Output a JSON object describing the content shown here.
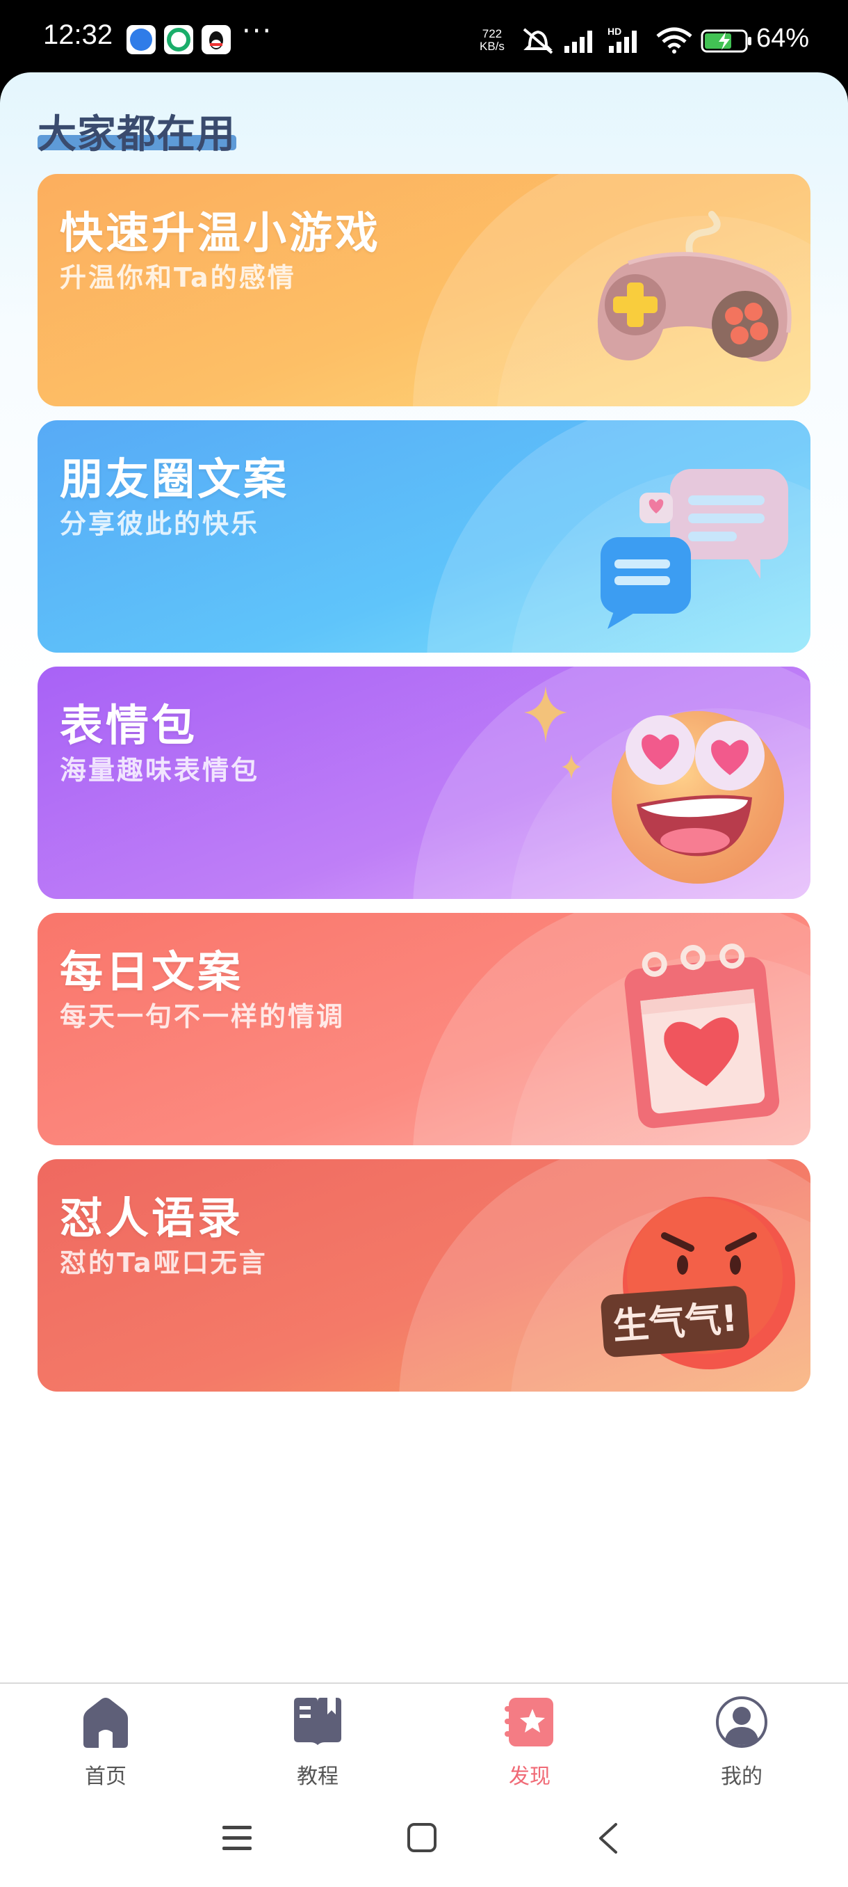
{
  "status_bar": {
    "time": "12:32",
    "net_speed_value": "722",
    "net_speed_unit": "KB/s",
    "battery_percent": "64%",
    "icons": [
      "browser-icon",
      "app-icon",
      "qq-icon",
      "more-icon",
      "mute-icon",
      "signal-icon",
      "signal-hd-icon",
      "wifi-icon",
      "battery-charging-icon"
    ]
  },
  "section": {
    "title": "大家都在用"
  },
  "cards": [
    {
      "title": "快速升温小游戏",
      "subtitle": "升温你和Ta的感情",
      "art": "gamepad-icon",
      "color": "#fdb25f"
    },
    {
      "title": "朋友圈文案",
      "subtitle": "分享彼此的快乐",
      "art": "chat-bubbles-icon",
      "color": "#5ab3f7"
    },
    {
      "title": "表情包",
      "subtitle": "海量趣味表情包",
      "art": "heart-eyes-emoji-icon",
      "color": "#b06cf6"
    },
    {
      "title": "每日文案",
      "subtitle": "每天一句不一样的情调",
      "art": "heart-calendar-icon",
      "color": "#fa7b70"
    },
    {
      "title": "怼人语录",
      "subtitle": "怼的Ta哑口无言",
      "art": "angry-face-icon",
      "art_text": "生气气!",
      "color": "#ef6b60"
    }
  ],
  "bottom_nav": {
    "items": [
      {
        "label": "首页",
        "icon": "home-icon",
        "active": false
      },
      {
        "label": "教程",
        "icon": "book-icon",
        "active": false
      },
      {
        "label": "发现",
        "icon": "discover-star-icon",
        "active": true
      },
      {
        "label": "我的",
        "icon": "profile-icon",
        "active": false
      }
    ],
    "active_color": "#f06a76"
  }
}
